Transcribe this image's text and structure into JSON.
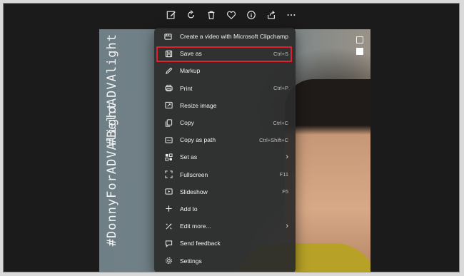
{
  "toolbar": {
    "icons": [
      "edit-image-icon",
      "rotate-icon",
      "delete-icon",
      "favorite-icon",
      "info-icon",
      "share-icon",
      "more-icon"
    ]
  },
  "photo": {
    "hashtag_1": "#DonnyForADVAlight",
    "hashtag_2": "#BeloADVAlight"
  },
  "menu": {
    "items": [
      {
        "label": "Create a video with Microsoft Clipchamp",
        "shortcut": "",
        "icon": "clipchamp-icon"
      },
      {
        "label": "Save as",
        "shortcut": "Ctrl+S",
        "icon": "save-icon",
        "highlighted": true
      },
      {
        "label": "Markup",
        "shortcut": "",
        "icon": "markup-icon"
      },
      {
        "label": "Print",
        "shortcut": "Ctrl+P",
        "icon": "print-icon"
      },
      {
        "label": "Resize image",
        "shortcut": "",
        "icon": "resize-icon"
      },
      {
        "label": "Copy",
        "shortcut": "Ctrl+C",
        "icon": "copy-icon"
      },
      {
        "label": "Copy as path",
        "shortcut": "Ctrl+Shift+C",
        "icon": "copy-path-icon"
      },
      {
        "label": "Set as",
        "shortcut": "",
        "icon": "set-as-icon",
        "submenu": true
      },
      {
        "label": "Fullscreen",
        "shortcut": "F11",
        "icon": "fullscreen-icon"
      },
      {
        "label": "Slideshow",
        "shortcut": "F5",
        "icon": "slideshow-icon"
      },
      {
        "label": "Add to",
        "shortcut": "",
        "icon": "add-icon"
      },
      {
        "label": "Edit more...",
        "shortcut": "",
        "icon": "edit-more-icon",
        "submenu": true
      },
      {
        "label": "Send feedback",
        "shortcut": "",
        "icon": "feedback-icon"
      },
      {
        "label": "Settings",
        "shortcut": "",
        "icon": "settings-icon"
      }
    ]
  },
  "colors": {
    "highlight_border": "#e0202a",
    "menu_bg": "#2c2c2c",
    "window_bg": "#1b1b1b"
  }
}
